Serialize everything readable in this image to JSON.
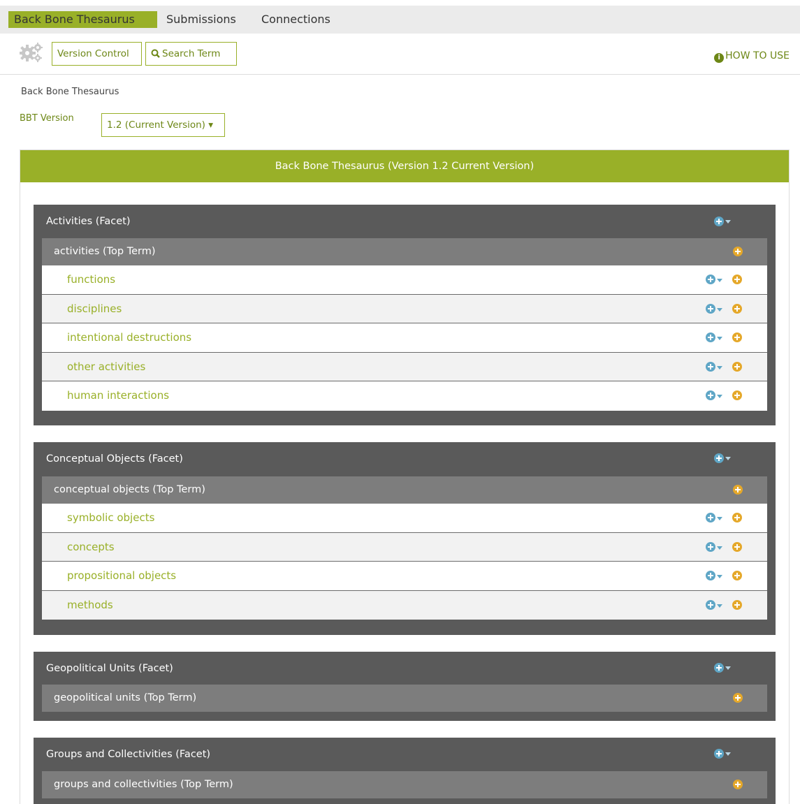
{
  "nav": {
    "tabs": [
      "Back Bone Thesaurus",
      "Submissions",
      "Connections"
    ]
  },
  "toolbar": {
    "version_control": "Version Control",
    "search_term": "Search Term",
    "how_to_use": "HOW TO USE"
  },
  "breadcrumb": "Back Bone Thesaurus",
  "version": {
    "label": "BBT Version",
    "selected": "1.2 (Current Version) ▾"
  },
  "panel": {
    "title": "Back Bone Thesaurus (Version 1.2 Current Version)"
  },
  "facets": [
    {
      "title": "Activities (Facet)",
      "top_term": "activities (Top Term)",
      "terms": [
        "functions",
        "disciplines",
        "intentional destructions",
        "other activities",
        "human interactions"
      ]
    },
    {
      "title": "Conceptual Objects (Facet)",
      "top_term": "conceptual objects (Top Term)",
      "terms": [
        "symbolic objects",
        "concepts",
        "propositional objects",
        "methods"
      ]
    },
    {
      "title": "Geopolitical Units (Facet)",
      "top_term": "geopolitical units (Top Term)",
      "terms": []
    },
    {
      "title": "Groups and Collectivities (Facet)",
      "top_term": "groups and collectivities (Top Term)",
      "terms": []
    }
  ],
  "colors": {
    "accent": "#99b028",
    "facet_bg": "#5a5a5a",
    "top_term_bg": "#7d7d7d",
    "blue_icon": "#5fa6c6",
    "orange_icon": "#e5a82a"
  },
  "icons": {
    "settings": "gears-icon",
    "search": "search-icon",
    "info": "info-icon",
    "add_child": "plus-circle-blue-icon",
    "add_term": "plus-circle-orange-icon"
  }
}
